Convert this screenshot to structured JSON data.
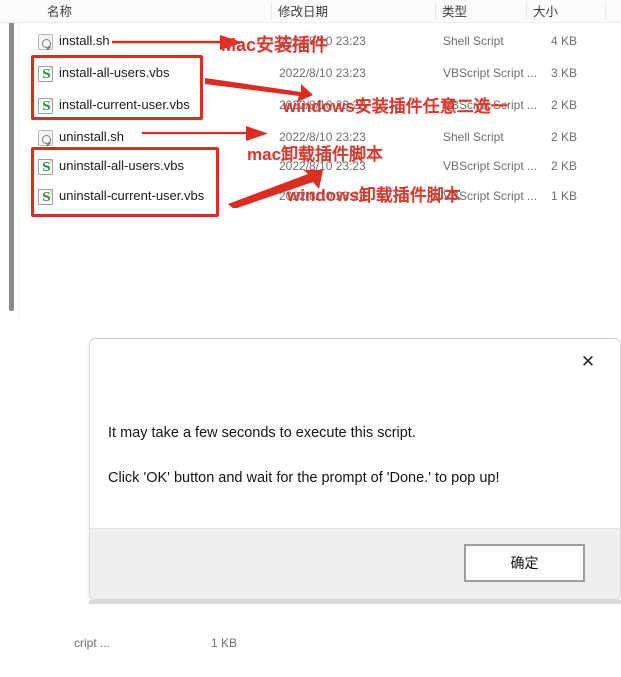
{
  "explorer": {
    "columns": [
      {
        "key": "name",
        "label": "名称"
      },
      {
        "key": "date",
        "label": "修改日期"
      },
      {
        "key": "type",
        "label": "类型"
      },
      {
        "key": "size",
        "label": "大小"
      }
    ],
    "rows": [
      {
        "icon": "shell-script-icon",
        "name": "install.sh",
        "date": "2022/8/10 23:23",
        "type": "Shell Script",
        "size": "4 KB"
      },
      {
        "icon": "vbscript-icon",
        "name": "install-all-users.vbs",
        "date": "2022/8/10 23:23",
        "type": "VBScript Script ...",
        "size": "3 KB"
      },
      {
        "icon": "vbscript-icon",
        "name": "install-current-user.vbs",
        "date": "2022/8/10 23:23",
        "type": "VBScript Script ...",
        "size": "2 KB"
      },
      {
        "icon": "shell-script-icon",
        "name": "uninstall.sh",
        "date": "2022/8/10 23:23",
        "type": "Shell Script",
        "size": "2 KB"
      },
      {
        "icon": "vbscript-icon",
        "name": "uninstall-all-users.vbs",
        "date": "2022/8/10 23:23",
        "type": "VBScript Script ...",
        "size": "2 KB"
      },
      {
        "icon": "vbscript-icon",
        "name": "uninstall-current-user.vbs",
        "date": "2022/8/10 23:23",
        "type": "VBScript Script ...",
        "size": "1 KB"
      }
    ]
  },
  "annotations": {
    "color": "#e0352a",
    "labels": [
      {
        "id": "mac-install",
        "text": "Mac安装插件"
      },
      {
        "id": "windows-install",
        "text": "windows安装插件任意二选一"
      },
      {
        "id": "mac-uninstall",
        "text": "mac卸载插件脚本"
      },
      {
        "id": "windows-uninstall",
        "text": "windows卸载插件脚本"
      }
    ]
  },
  "dialog": {
    "line1": "It may take a few seconds to execute this script.",
    "line2": "Click 'OK' button and wait for the prompt of 'Done.' to pop up!",
    "ok_label": "确定",
    "close_label": "✕"
  },
  "bottom_strip": {
    "type_fragment": "cript ...",
    "size": "1 KB"
  }
}
